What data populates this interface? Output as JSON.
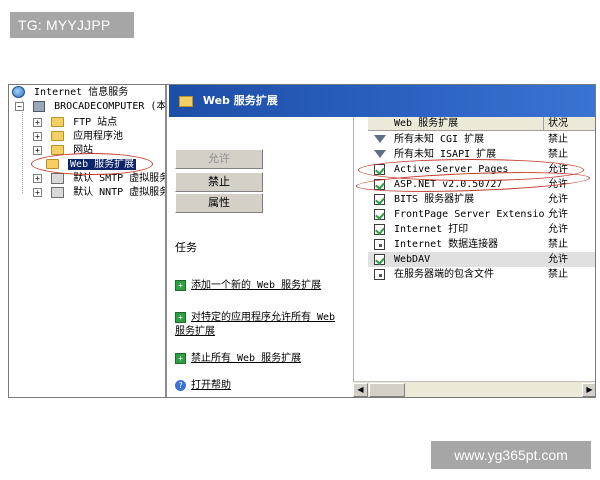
{
  "watermarks": {
    "top": "TG: MYYJJPP",
    "bottom": "www.yg365pt.com"
  },
  "tree": {
    "root": "Internet 信息服务",
    "computer": "BROCADECOMPUTER (本地计",
    "children": [
      {
        "label": "FTP 站点",
        "icon": "folder-icon"
      },
      {
        "label": "应用程序池",
        "icon": "folder-icon"
      },
      {
        "label": "网站",
        "icon": "folder-icon"
      },
      {
        "label": "Web 服务扩展",
        "icon": "folder-icon",
        "selected": true
      },
      {
        "label": "默认 SMTP 虚拟服务",
        "icon": "smtp-icon"
      },
      {
        "label": "默认 NNTP 虚拟服务",
        "icon": "nntp-icon"
      }
    ]
  },
  "header": {
    "title": "Web 服务扩展"
  },
  "tasks": {
    "buttons": {
      "allow": "允许",
      "prohibit": "禁止",
      "properties": "属性"
    },
    "heading": "任务",
    "links": [
      "添加一个新的 Web 服务扩展",
      "对特定的应用程序允许所有 Web 服务扩展",
      "禁止所有 Web 服务扩展"
    ],
    "help": "打开帮助"
  },
  "list": {
    "columns": {
      "name": "Web 服务扩展",
      "status": "状况"
    },
    "rows": [
      {
        "name": "所有未知 CGI 扩展",
        "status": "禁止",
        "icon": "filter-icon"
      },
      {
        "name": "所有未知 ISAPI 扩展",
        "status": "禁止",
        "icon": "filter-icon"
      },
      {
        "name": "Active Server Pages",
        "status": "允许",
        "icon": "allowed-icon"
      },
      {
        "name": "ASP.NET v2.0.50727",
        "status": "允许",
        "icon": "allowed-icon"
      },
      {
        "name": "BITS 服务器扩展",
        "status": "允许",
        "icon": "allowed-icon"
      },
      {
        "name": "FrontPage Server Extensio...",
        "status": "允许",
        "icon": "allowed-icon"
      },
      {
        "name": "Internet 打印",
        "status": "允许",
        "icon": "allowed-icon"
      },
      {
        "name": "Internet 数据连接器",
        "status": "禁止",
        "icon": "prohibited-icon"
      },
      {
        "name": "WebDAV",
        "status": "允许",
        "icon": "allowed-icon",
        "selected": true
      },
      {
        "name": "在服务器端的包含文件",
        "status": "禁止",
        "icon": "prohibited-icon"
      }
    ]
  },
  "colors": {
    "header_blue": "#2c63c4",
    "selection_navy": "#0b246a",
    "highlight_red": "#c0392b",
    "watermark_gray": "#a6a6a6"
  }
}
